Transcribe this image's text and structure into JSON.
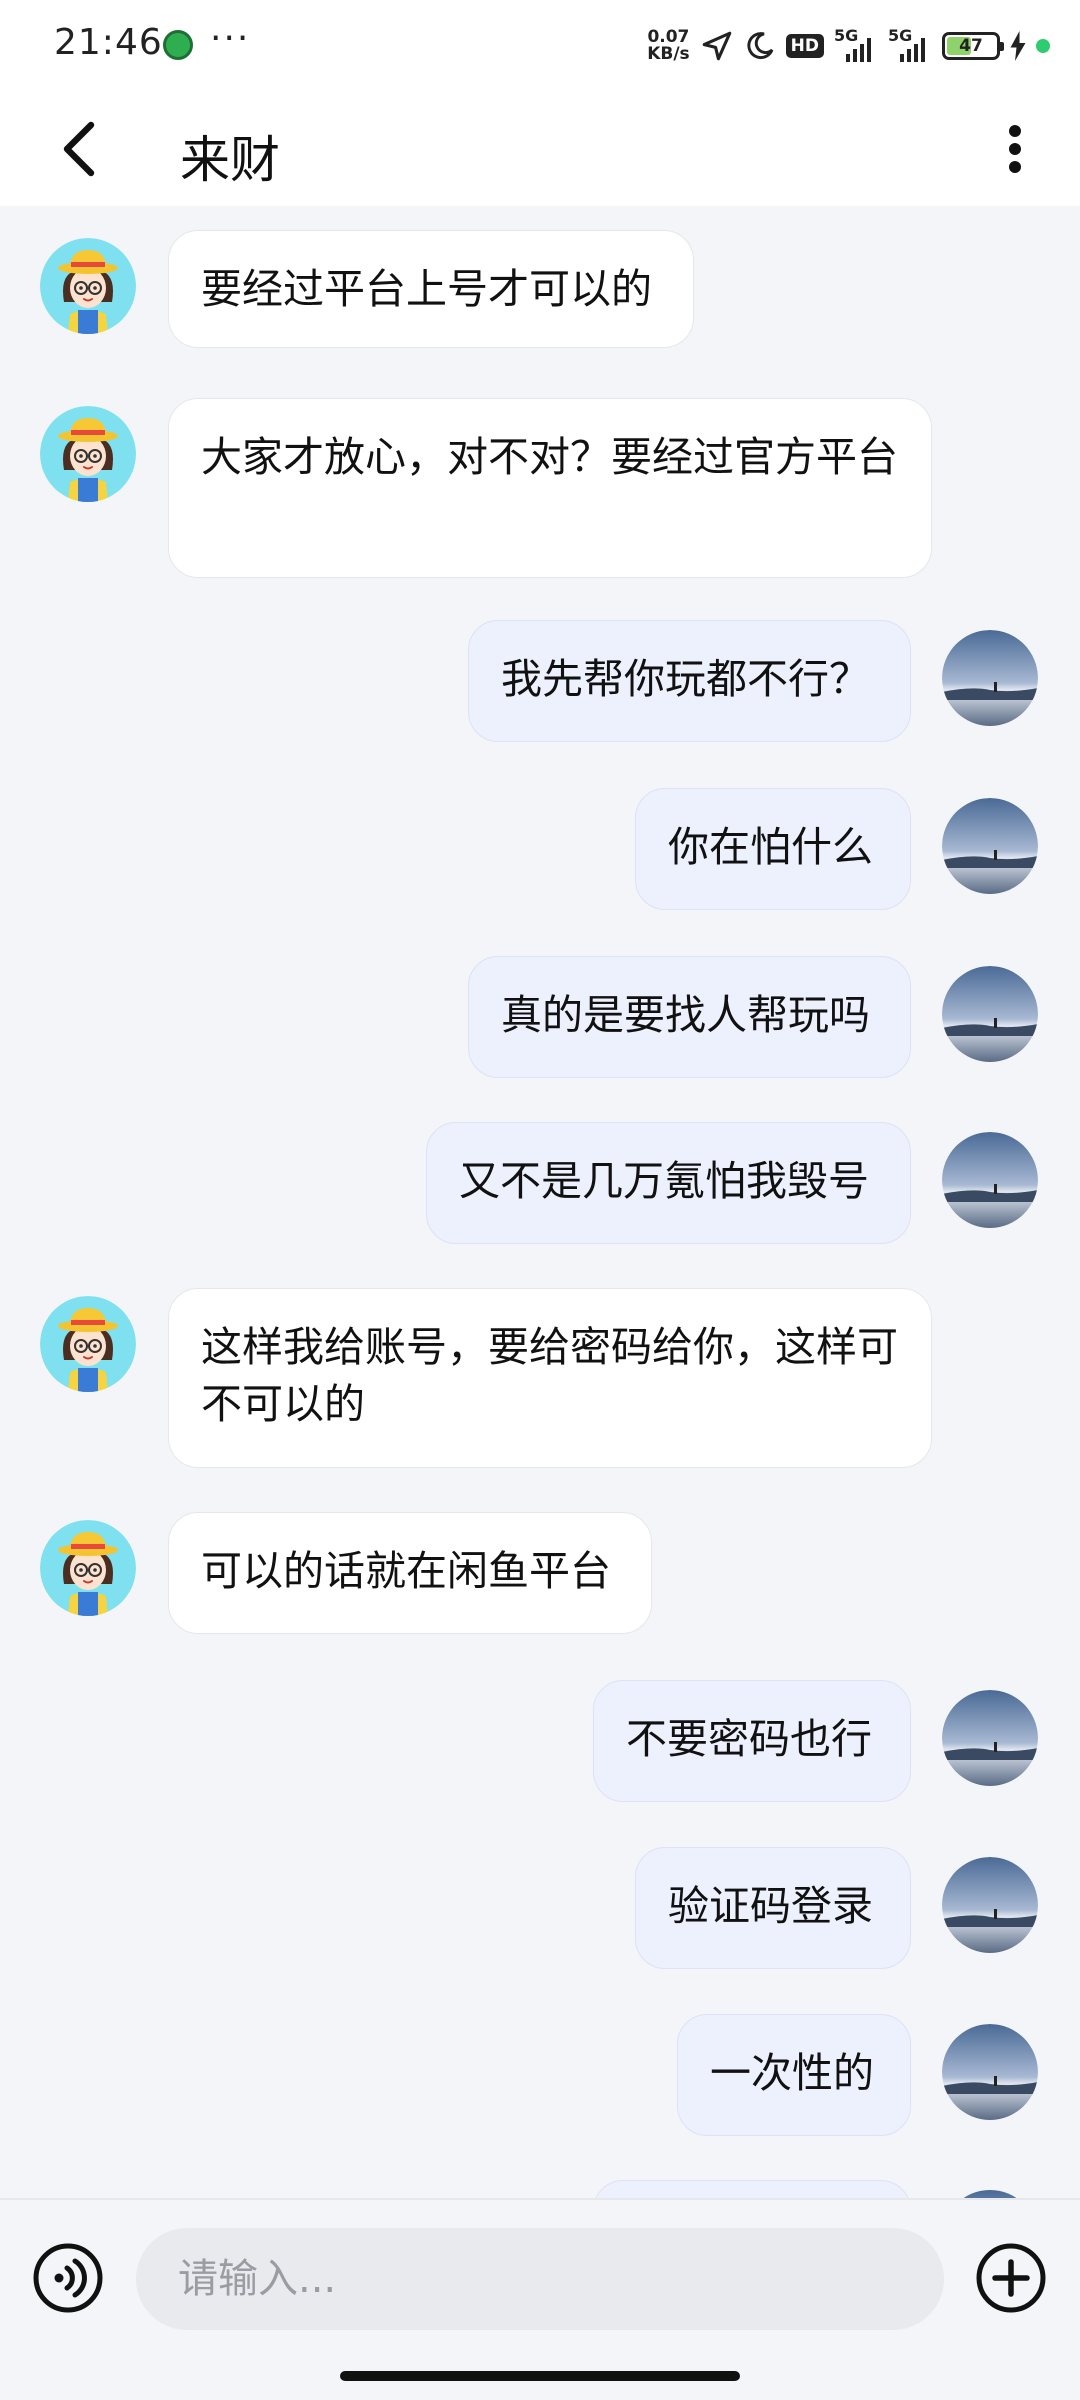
{
  "status_bar": {
    "time": "21:46",
    "more": "···",
    "net_speed_value": "0.07",
    "net_speed_unit": "KB/s",
    "hd_label": "HD",
    "signal1_label": "5G",
    "signal2_label": "5G",
    "battery_level": "47",
    "icons": [
      "app-notification-icon",
      "location-arrow-icon",
      "moon-icon",
      "signal-icon",
      "battery-icon",
      "charging-icon"
    ]
  },
  "header": {
    "title": "来财",
    "back_icon": "chevron-left-icon",
    "more_icon": "vertical-dots-icon"
  },
  "messages": [
    {
      "side": "left",
      "text": "要经过平台上号才可以的"
    },
    {
      "side": "left",
      "text": "大家才放心，对不对？要经过官方平台"
    },
    {
      "side": "right",
      "text": "我先帮你玩都不行？"
    },
    {
      "side": "right",
      "text": "你在怕什么"
    },
    {
      "side": "right",
      "text": "真的是要找人帮玩吗"
    },
    {
      "side": "right",
      "text": "又不是几万氪怕我毁号"
    },
    {
      "side": "left",
      "text": "这样我给账号，要给密码给你，这样可不可以的"
    },
    {
      "side": "left",
      "text": "可以的话就在闲鱼平台"
    },
    {
      "side": "right",
      "text": "不要密码也行"
    },
    {
      "side": "right",
      "text": "验证码登录"
    },
    {
      "side": "right",
      "text": "一次性的"
    }
  ],
  "input": {
    "placeholder": "请输入...",
    "value": "",
    "voice_icon": "voice-wave-icon",
    "plus_icon": "plus-circle-icon"
  },
  "colors": {
    "background": "#f4f5f8",
    "bubble_left": "#ffffff",
    "bubble_right": "#edf0fd"
  }
}
